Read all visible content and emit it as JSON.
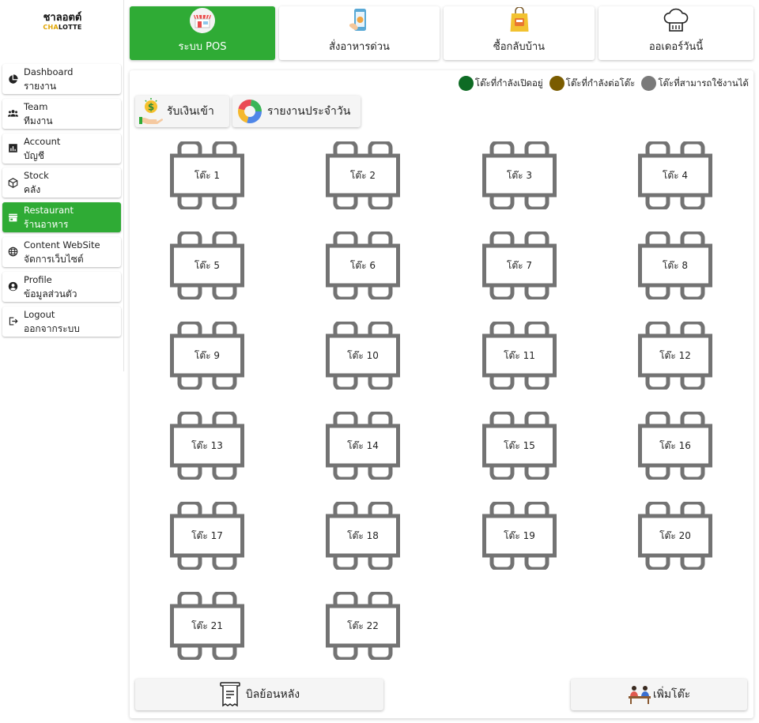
{
  "brand": {
    "name_th": "ชาลอตต์",
    "name_en_a": "CHA",
    "name_en_b": "LOTTE"
  },
  "sidebar": {
    "items": [
      {
        "en": "Dashboard",
        "th": "รายงาน",
        "icon": "pie-chart-icon",
        "active": false
      },
      {
        "en": "Team",
        "th": "ทีมงาน",
        "icon": "people-icon",
        "active": false
      },
      {
        "en": "Account",
        "th": "บัญชี",
        "icon": "bar-chart-icon",
        "active": false
      },
      {
        "en": "Stock",
        "th": "คลัง",
        "icon": "box-icon",
        "active": false
      },
      {
        "en": "Restaurant",
        "th": "ร้านอาหาร",
        "icon": "store-icon",
        "active": true
      },
      {
        "en": "Content WebSite",
        "th": "จัดการเว็บไซต์",
        "icon": "globe-icon",
        "active": false
      },
      {
        "en": "Profile",
        "th": "ข้อมูลส่วนตัว",
        "icon": "user-circle-icon",
        "active": false
      },
      {
        "en": "Logout",
        "th": "ออกจากระบบ",
        "icon": "logout-icon",
        "active": false
      }
    ]
  },
  "tabs": [
    {
      "label": "ระบบ POS",
      "icon": "pos-store-icon",
      "active": true
    },
    {
      "label": "สั่งอาหารด่วน",
      "icon": "mobile-order-icon",
      "active": false
    },
    {
      "label": "ซื้อกลับบ้าน",
      "icon": "takeaway-bag-icon",
      "active": false
    },
    {
      "label": "ออเดอร์วันนี้",
      "icon": "chef-hat-icon",
      "active": false
    }
  ],
  "legend": [
    {
      "label": "โต๊ะที่กำลังเปิดอยู่",
      "color": "#0e6b24"
    },
    {
      "label": "โต๊ะที่กำลังต่อโต๊ะ",
      "color": "#7a5c00"
    },
    {
      "label": "โต๊ะที่สามารถใช้งานได้",
      "color": "#7a7a7a"
    }
  ],
  "actions": {
    "receive_money": "รับเงินเข้า",
    "daily_report": "รายงานประจำวัน"
  },
  "tables": [
    "โต๊ะ 1",
    "โต๊ะ 2",
    "โต๊ะ 3",
    "โต๊ะ 4",
    "โต๊ะ 5",
    "โต๊ะ 6",
    "โต๊ะ 7",
    "โต๊ะ 8",
    "โต๊ะ 9",
    "โต๊ะ 10",
    "โต๊ะ 11",
    "โต๊ะ 12",
    "โต๊ะ 13",
    "โต๊ะ 14",
    "โต๊ะ 15",
    "โต๊ะ 16",
    "โต๊ะ 17",
    "โต๊ะ 18",
    "โต๊ะ 19",
    "โต๊ะ 20",
    "โต๊ะ 21",
    "โต๊ะ 22"
  ],
  "table_color": "#737373",
  "bottom": {
    "bill_history": "บิลย้อนหลัง",
    "add_table": "เพิ่มโต๊ะ"
  },
  "colors": {
    "accent": "#2fab35"
  }
}
